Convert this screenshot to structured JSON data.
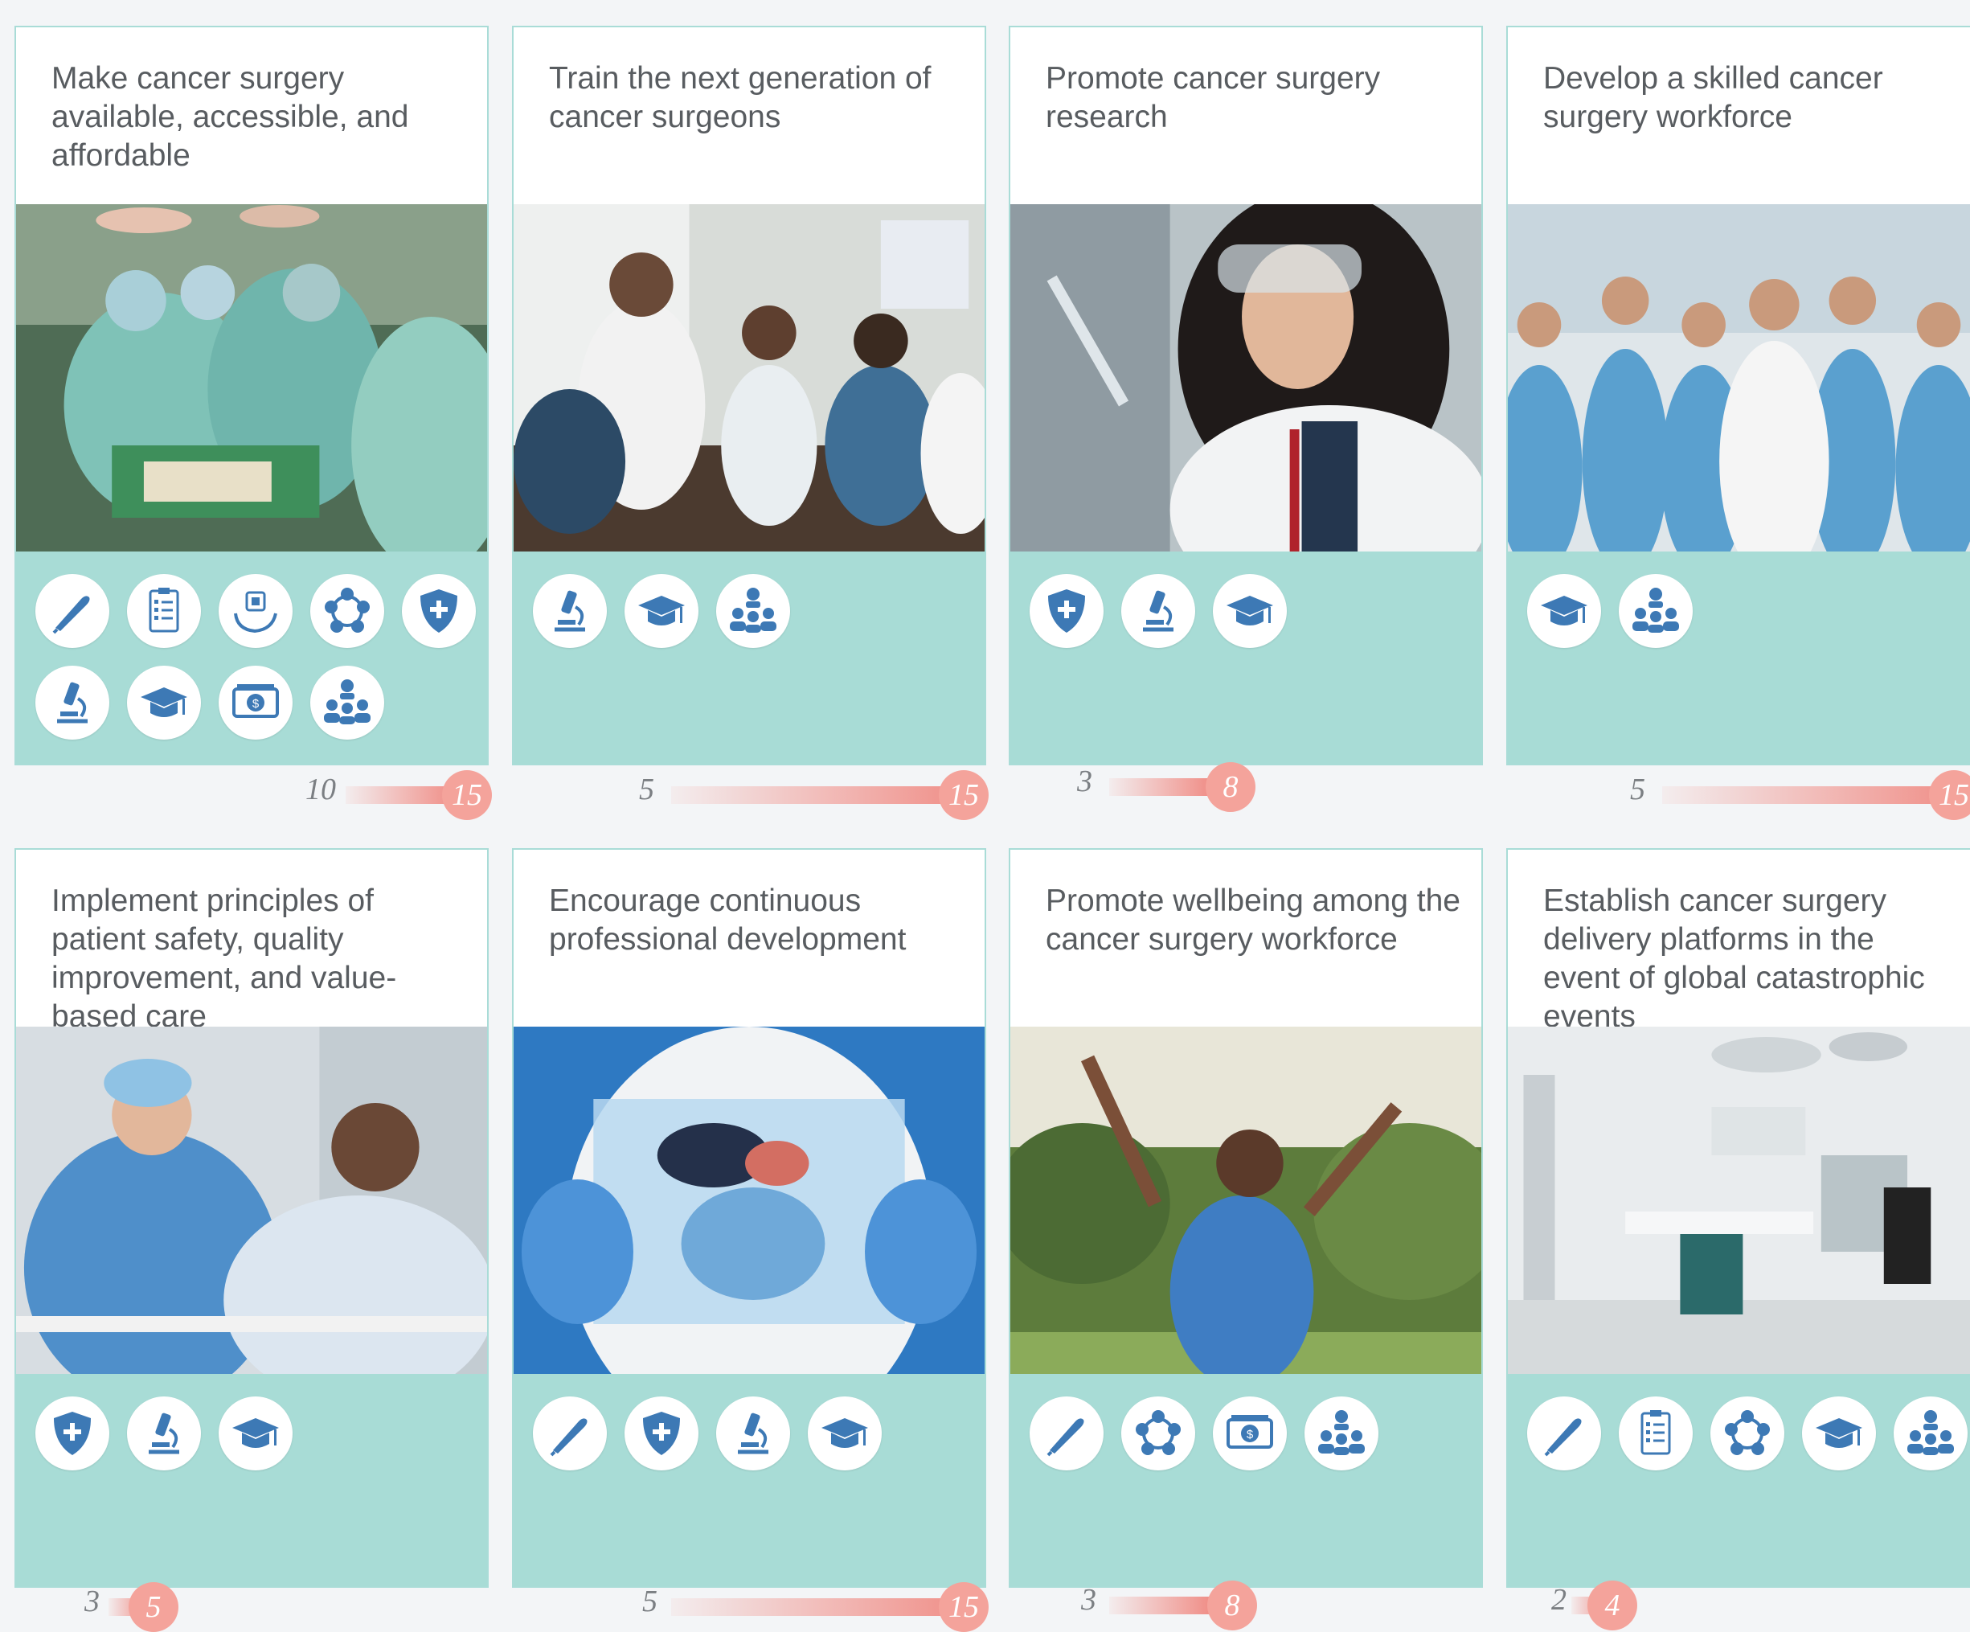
{
  "cards": [
    {
      "title": "Make  cancer surgery available, accessible, and affordable",
      "photo": "operating-team-photo",
      "icons": [
        "scalpel-icon",
        "checklist-icon",
        "health-tech-icon",
        "network-icon",
        "shield-icon",
        "microscope-icon",
        "graduation-cap-icon",
        "money-icon",
        "team-meeting-icon"
      ],
      "gauge": {
        "min": "10",
        "max": "15"
      }
    },
    {
      "title": "Train the next generation of cancer surgeons",
      "photo": "classroom-photo",
      "icons": [
        "microscope-icon",
        "graduation-cap-icon",
        "team-meeting-icon"
      ],
      "gauge": {
        "min": "5",
        "max": "15"
      }
    },
    {
      "title": "Promote cancer surgery research",
      "photo": "researcher-photo",
      "icons": [
        "shield-icon",
        "microscope-icon",
        "graduation-cap-icon"
      ],
      "gauge": {
        "min": "3",
        "max": "8"
      }
    },
    {
      "title": "Develop a skilled cancer surgery workforce",
      "photo": "workforce-photo",
      "icons": [
        "graduation-cap-icon",
        "team-meeting-icon"
      ],
      "gauge": {
        "min": "5",
        "max": "15"
      }
    },
    {
      "title": "Implement principles of patient safety, quality improvement, and value-based care",
      "photo": "patient-care-photo",
      "icons": [
        "shield-icon",
        "microscope-icon",
        "graduation-cap-icon"
      ],
      "gauge": {
        "min": "3",
        "max": "5"
      }
    },
    {
      "title": "Encourage continuous professional development",
      "photo": "anatomy-photo",
      "icons": [
        "scalpel-icon",
        "shield-icon",
        "microscope-icon",
        "graduation-cap-icon"
      ],
      "gauge": {
        "min": "5",
        "max": "15"
      }
    },
    {
      "title": "Promote wellbeing among the cancer surgery workforce",
      "photo": "wellbeing-photo",
      "icons": [
        "scalpel-icon",
        "network-icon",
        "money-icon",
        "team-meeting-icon"
      ],
      "gauge": {
        "min": "3",
        "max": "8"
      }
    },
    {
      "title": "Establish cancer surgery delivery platforms in the event of global catastrophic events",
      "photo": "operating-room-photo",
      "icons": [
        "scalpel-icon",
        "checklist-icon",
        "network-icon",
        "graduation-cap-icon",
        "team-meeting-icon"
      ],
      "gauge": {
        "min": "2",
        "max": "4"
      }
    }
  ],
  "colors": {
    "teal_panel": "#a8dcd6",
    "icon_blue": "#3d79b5",
    "gauge_red": "#f08b84",
    "gauge_badge": "#f4a39b"
  }
}
